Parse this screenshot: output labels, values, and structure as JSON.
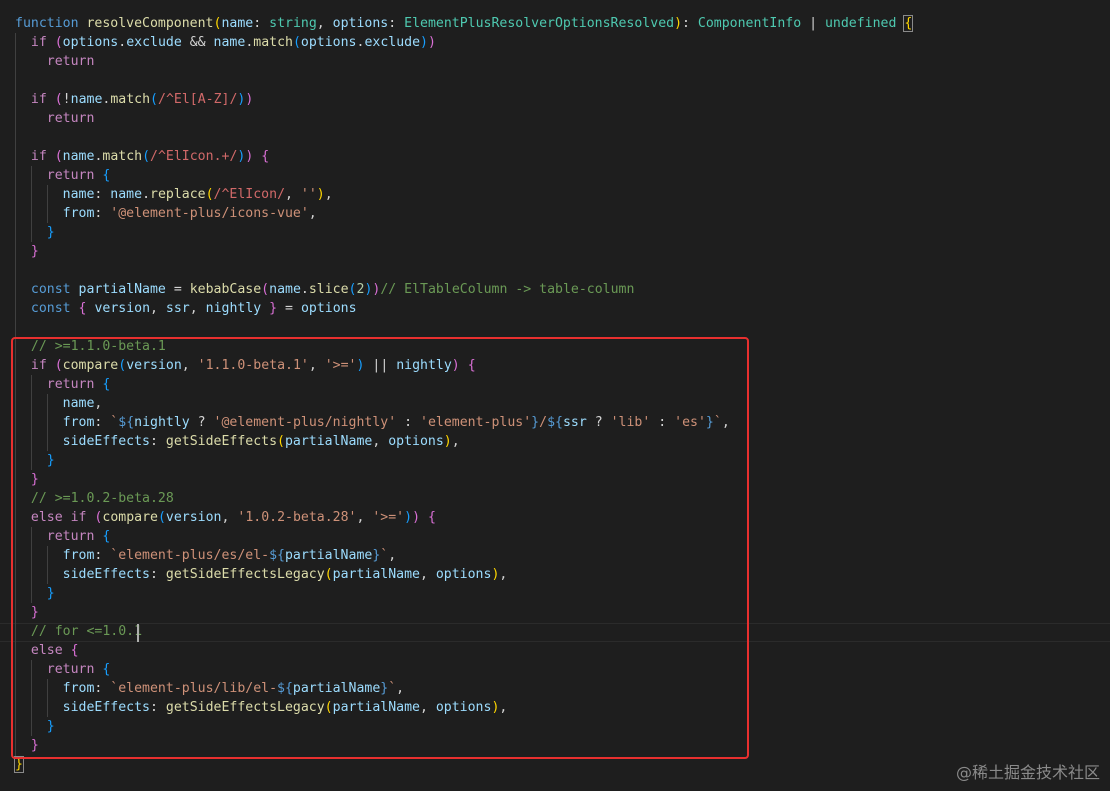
{
  "editor": {
    "lines": [
      [
        [
          "keyword",
          "function "
        ],
        [
          "func",
          "resolveComponent"
        ],
        [
          "b1",
          "("
        ],
        [
          "param",
          "name"
        ],
        [
          "plain",
          ": "
        ],
        [
          "type",
          "string"
        ],
        [
          "plain",
          ", "
        ],
        [
          "param",
          "options"
        ],
        [
          "plain",
          ": "
        ],
        [
          "type",
          "ElementPlusResolverOptionsResolved"
        ],
        [
          "b1",
          ")"
        ],
        [
          "plain",
          ": "
        ],
        [
          "type",
          "ComponentInfo"
        ],
        [
          "plain",
          " | "
        ],
        [
          "type",
          "undefined"
        ],
        [
          "plain",
          " "
        ],
        [
          "b1hl",
          "{"
        ]
      ],
      [
        [
          "plain",
          "  "
        ],
        [
          "control",
          "if "
        ],
        [
          "b2",
          "("
        ],
        [
          "param",
          "options"
        ],
        [
          "plain",
          "."
        ],
        [
          "param",
          "exclude"
        ],
        [
          "plain",
          " && "
        ],
        [
          "param",
          "name"
        ],
        [
          "plain",
          "."
        ],
        [
          "func",
          "match"
        ],
        [
          "b3",
          "("
        ],
        [
          "param",
          "options"
        ],
        [
          "plain",
          "."
        ],
        [
          "param",
          "exclude"
        ],
        [
          "b3",
          ")"
        ],
        [
          "b2",
          ")"
        ]
      ],
      [
        [
          "plain",
          "    "
        ],
        [
          "control",
          "return"
        ]
      ],
      [],
      [
        [
          "plain",
          "  "
        ],
        [
          "control",
          "if "
        ],
        [
          "b2",
          "("
        ],
        [
          "plain",
          "!"
        ],
        [
          "param",
          "name"
        ],
        [
          "plain",
          "."
        ],
        [
          "func",
          "match"
        ],
        [
          "b3",
          "("
        ],
        [
          "regex",
          "/^El[A-Z]/"
        ],
        [
          "b3",
          ")"
        ],
        [
          "b2",
          ")"
        ]
      ],
      [
        [
          "plain",
          "    "
        ],
        [
          "control",
          "return"
        ]
      ],
      [],
      [
        [
          "plain",
          "  "
        ],
        [
          "control",
          "if "
        ],
        [
          "b2",
          "("
        ],
        [
          "param",
          "name"
        ],
        [
          "plain",
          "."
        ],
        [
          "func",
          "match"
        ],
        [
          "b3",
          "("
        ],
        [
          "regex",
          "/^ElIcon.+/"
        ],
        [
          "b3",
          ")"
        ],
        [
          "b2",
          ")"
        ],
        [
          "plain",
          " "
        ],
        [
          "b2",
          "{"
        ]
      ],
      [
        [
          "plain",
          "    "
        ],
        [
          "control",
          "return "
        ],
        [
          "b3",
          "{"
        ]
      ],
      [
        [
          "plain",
          "      "
        ],
        [
          "param",
          "name"
        ],
        [
          "plain",
          ": "
        ],
        [
          "param",
          "name"
        ],
        [
          "plain",
          "."
        ],
        [
          "func",
          "replace"
        ],
        [
          "b1",
          "("
        ],
        [
          "regex",
          "/^ElIcon/"
        ],
        [
          "plain",
          ", "
        ],
        [
          "string",
          "''"
        ],
        [
          "b1",
          ")"
        ],
        [
          "plain",
          ","
        ]
      ],
      [
        [
          "plain",
          "      "
        ],
        [
          "param",
          "from"
        ],
        [
          "plain",
          ": "
        ],
        [
          "string",
          "'@element-plus/icons-vue'"
        ],
        [
          "plain",
          ","
        ]
      ],
      [
        [
          "plain",
          "    "
        ],
        [
          "b3",
          "}"
        ]
      ],
      [
        [
          "plain",
          "  "
        ],
        [
          "b2",
          "}"
        ]
      ],
      [],
      [
        [
          "plain",
          "  "
        ],
        [
          "keyword",
          "const "
        ],
        [
          "param",
          "partialName"
        ],
        [
          "plain",
          " = "
        ],
        [
          "func",
          "kebabCase"
        ],
        [
          "b2",
          "("
        ],
        [
          "param",
          "name"
        ],
        [
          "plain",
          "."
        ],
        [
          "func",
          "slice"
        ],
        [
          "b3",
          "("
        ],
        [
          "number",
          "2"
        ],
        [
          "b3",
          ")"
        ],
        [
          "b2",
          ")"
        ],
        [
          "comment",
          "// ElTableColumn -> table-column"
        ]
      ],
      [
        [
          "plain",
          "  "
        ],
        [
          "keyword",
          "const "
        ],
        [
          "b2",
          "{"
        ],
        [
          "plain",
          " "
        ],
        [
          "param",
          "version"
        ],
        [
          "plain",
          ", "
        ],
        [
          "param",
          "ssr"
        ],
        [
          "plain",
          ", "
        ],
        [
          "param",
          "nightly"
        ],
        [
          "plain",
          " "
        ],
        [
          "b2",
          "}"
        ],
        [
          "plain",
          " = "
        ],
        [
          "param",
          "options"
        ]
      ],
      [],
      [
        [
          "plain",
          "  "
        ],
        [
          "comment",
          "// >=1.1.0-beta.1"
        ]
      ],
      [
        [
          "plain",
          "  "
        ],
        [
          "control",
          "if "
        ],
        [
          "b2",
          "("
        ],
        [
          "func",
          "compare"
        ],
        [
          "b3",
          "("
        ],
        [
          "param",
          "version"
        ],
        [
          "plain",
          ", "
        ],
        [
          "string",
          "'1.1.0-beta.1'"
        ],
        [
          "plain",
          ", "
        ],
        [
          "string",
          "'>='"
        ],
        [
          "b3",
          ")"
        ],
        [
          "plain",
          " || "
        ],
        [
          "param",
          "nightly"
        ],
        [
          "b2",
          ")"
        ],
        [
          "plain",
          " "
        ],
        [
          "b2",
          "{"
        ]
      ],
      [
        [
          "plain",
          "    "
        ],
        [
          "control",
          "return "
        ],
        [
          "b3",
          "{"
        ]
      ],
      [
        [
          "plain",
          "      "
        ],
        [
          "param",
          "name"
        ],
        [
          "plain",
          ","
        ]
      ],
      [
        [
          "plain",
          "      "
        ],
        [
          "param",
          "from"
        ],
        [
          "plain",
          ": "
        ],
        [
          "string",
          "`"
        ],
        [
          "keyword",
          "${"
        ],
        [
          "param",
          "nightly"
        ],
        [
          "plain",
          " ? "
        ],
        [
          "string",
          "'@element-plus/nightly'"
        ],
        [
          "plain",
          " : "
        ],
        [
          "string",
          "'element-plus'"
        ],
        [
          "keyword",
          "}"
        ],
        [
          "string",
          "/"
        ],
        [
          "keyword",
          "${"
        ],
        [
          "param",
          "ssr"
        ],
        [
          "plain",
          " ? "
        ],
        [
          "string",
          "'lib'"
        ],
        [
          "plain",
          " : "
        ],
        [
          "string",
          "'es'"
        ],
        [
          "keyword",
          "}"
        ],
        [
          "string",
          "`"
        ],
        [
          "plain",
          ","
        ]
      ],
      [
        [
          "plain",
          "      "
        ],
        [
          "param",
          "sideEffects"
        ],
        [
          "plain",
          ": "
        ],
        [
          "func",
          "getSideEffects"
        ],
        [
          "b1",
          "("
        ],
        [
          "param",
          "partialName"
        ],
        [
          "plain",
          ", "
        ],
        [
          "param",
          "options"
        ],
        [
          "b1",
          ")"
        ],
        [
          "plain",
          ","
        ]
      ],
      [
        [
          "plain",
          "    "
        ],
        [
          "b3",
          "}"
        ]
      ],
      [
        [
          "plain",
          "  "
        ],
        [
          "b2",
          "}"
        ]
      ],
      [
        [
          "plain",
          "  "
        ],
        [
          "comment",
          "// >=1.0.2-beta.28"
        ]
      ],
      [
        [
          "plain",
          "  "
        ],
        [
          "control",
          "else if "
        ],
        [
          "b2",
          "("
        ],
        [
          "func",
          "compare"
        ],
        [
          "b3",
          "("
        ],
        [
          "param",
          "version"
        ],
        [
          "plain",
          ", "
        ],
        [
          "string",
          "'1.0.2-beta.28'"
        ],
        [
          "plain",
          ", "
        ],
        [
          "string",
          "'>='"
        ],
        [
          "b3",
          ")"
        ],
        [
          "b2",
          ")"
        ],
        [
          "plain",
          " "
        ],
        [
          "b2",
          "{"
        ]
      ],
      [
        [
          "plain",
          "    "
        ],
        [
          "control",
          "return "
        ],
        [
          "b3",
          "{"
        ]
      ],
      [
        [
          "plain",
          "      "
        ],
        [
          "param",
          "from"
        ],
        [
          "plain",
          ": "
        ],
        [
          "string",
          "`element-plus/es/el-"
        ],
        [
          "keyword",
          "${"
        ],
        [
          "param",
          "partialName"
        ],
        [
          "keyword",
          "}"
        ],
        [
          "string",
          "`"
        ],
        [
          "plain",
          ","
        ]
      ],
      [
        [
          "plain",
          "      "
        ],
        [
          "param",
          "sideEffects"
        ],
        [
          "plain",
          ": "
        ],
        [
          "func",
          "getSideEffectsLegacy"
        ],
        [
          "b1",
          "("
        ],
        [
          "param",
          "partialName"
        ],
        [
          "plain",
          ", "
        ],
        [
          "param",
          "options"
        ],
        [
          "b1",
          ")"
        ],
        [
          "plain",
          ","
        ]
      ],
      [
        [
          "plain",
          "    "
        ],
        [
          "b3",
          "}"
        ]
      ],
      [
        [
          "plain",
          "  "
        ],
        [
          "b2",
          "}"
        ]
      ],
      [
        [
          "plain",
          "  "
        ],
        [
          "comment",
          "// for <=1.0.1"
        ]
      ],
      [
        [
          "plain",
          "  "
        ],
        [
          "control",
          "else "
        ],
        [
          "b2",
          "{"
        ]
      ],
      [
        [
          "plain",
          "    "
        ],
        [
          "control",
          "return "
        ],
        [
          "b3",
          "{"
        ]
      ],
      [
        [
          "plain",
          "      "
        ],
        [
          "param",
          "from"
        ],
        [
          "plain",
          ": "
        ],
        [
          "string",
          "`element-plus/lib/el-"
        ],
        [
          "keyword",
          "${"
        ],
        [
          "param",
          "partialName"
        ],
        [
          "keyword",
          "}"
        ],
        [
          "string",
          "`"
        ],
        [
          "plain",
          ","
        ]
      ],
      [
        [
          "plain",
          "      "
        ],
        [
          "param",
          "sideEffects"
        ],
        [
          "plain",
          ": "
        ],
        [
          "func",
          "getSideEffectsLegacy"
        ],
        [
          "b1",
          "("
        ],
        [
          "param",
          "partialName"
        ],
        [
          "plain",
          ", "
        ],
        [
          "param",
          "options"
        ],
        [
          "b1",
          ")"
        ],
        [
          "plain",
          ","
        ]
      ],
      [
        [
          "plain",
          "    "
        ],
        [
          "b3",
          "}"
        ]
      ],
      [
        [
          "plain",
          "  "
        ],
        [
          "b2",
          "}"
        ]
      ],
      [
        [
          "b1hl",
          "}"
        ]
      ]
    ]
  },
  "watermark": "@稀土掘金技术社区",
  "colors": {
    "background": "#1e1e1e",
    "keyword": "#569cd6",
    "control": "#c586c0",
    "function": "#dcdcaa",
    "variable": "#9cdcfe",
    "type": "#4ec9b0",
    "string": "#ce9178",
    "regex": "#d16969",
    "comment": "#6a9955",
    "highlight_box": "#e8302f"
  }
}
